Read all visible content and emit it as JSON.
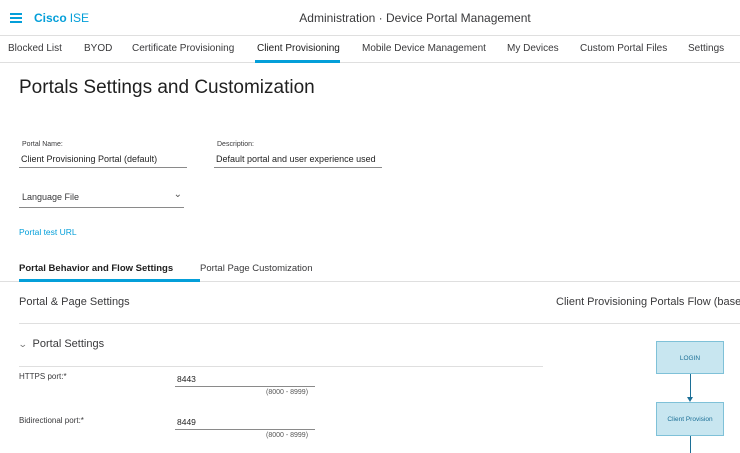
{
  "header": {
    "brand_cisco": "Cisco",
    "brand_product": "ISE",
    "page_heading": "Administration · Device Portal Management"
  },
  "tabs": [
    {
      "label": "Blocked List"
    },
    {
      "label": "BYOD"
    },
    {
      "label": "Certificate Provisioning"
    },
    {
      "label": "Client Provisioning",
      "active": true
    },
    {
      "label": "Mobile Device Management"
    },
    {
      "label": "My Devices"
    },
    {
      "label": "Custom Portal Files"
    },
    {
      "label": "Settings"
    }
  ],
  "main": {
    "title": "Portals Settings and Customization",
    "portal_name": {
      "label": "Portal Name:",
      "value": "Client Provisioning Portal (default)"
    },
    "description": {
      "label": "Description:",
      "value": "Default portal and user experience used"
    },
    "language_file": {
      "label": "Language File"
    },
    "test_link": "Portal test URL",
    "subtabs": [
      {
        "label": "Portal Behavior and Flow Settings",
        "active": true
      },
      {
        "label": "Portal Page Customization"
      }
    ],
    "section_title": "Portal & Page Settings",
    "flow_title": "Client Provisioning Portals Flow (based",
    "accordion": {
      "label": "Portal Settings"
    },
    "https_port": {
      "label": "HTTPS port:*",
      "value": "8443",
      "range": "(8000 - 8999)"
    },
    "bidirectional_port": {
      "label": "Bidirectional port:*",
      "value": "8449",
      "range": "(8000 - 8999)"
    },
    "flow": {
      "step1": "LOGIN",
      "step2": "Client Provision"
    }
  },
  "colors": {
    "accent": "#049fd9",
    "flow_box_bg": "#c8e6f0",
    "flow_box_border": "#7fc1d8"
  }
}
